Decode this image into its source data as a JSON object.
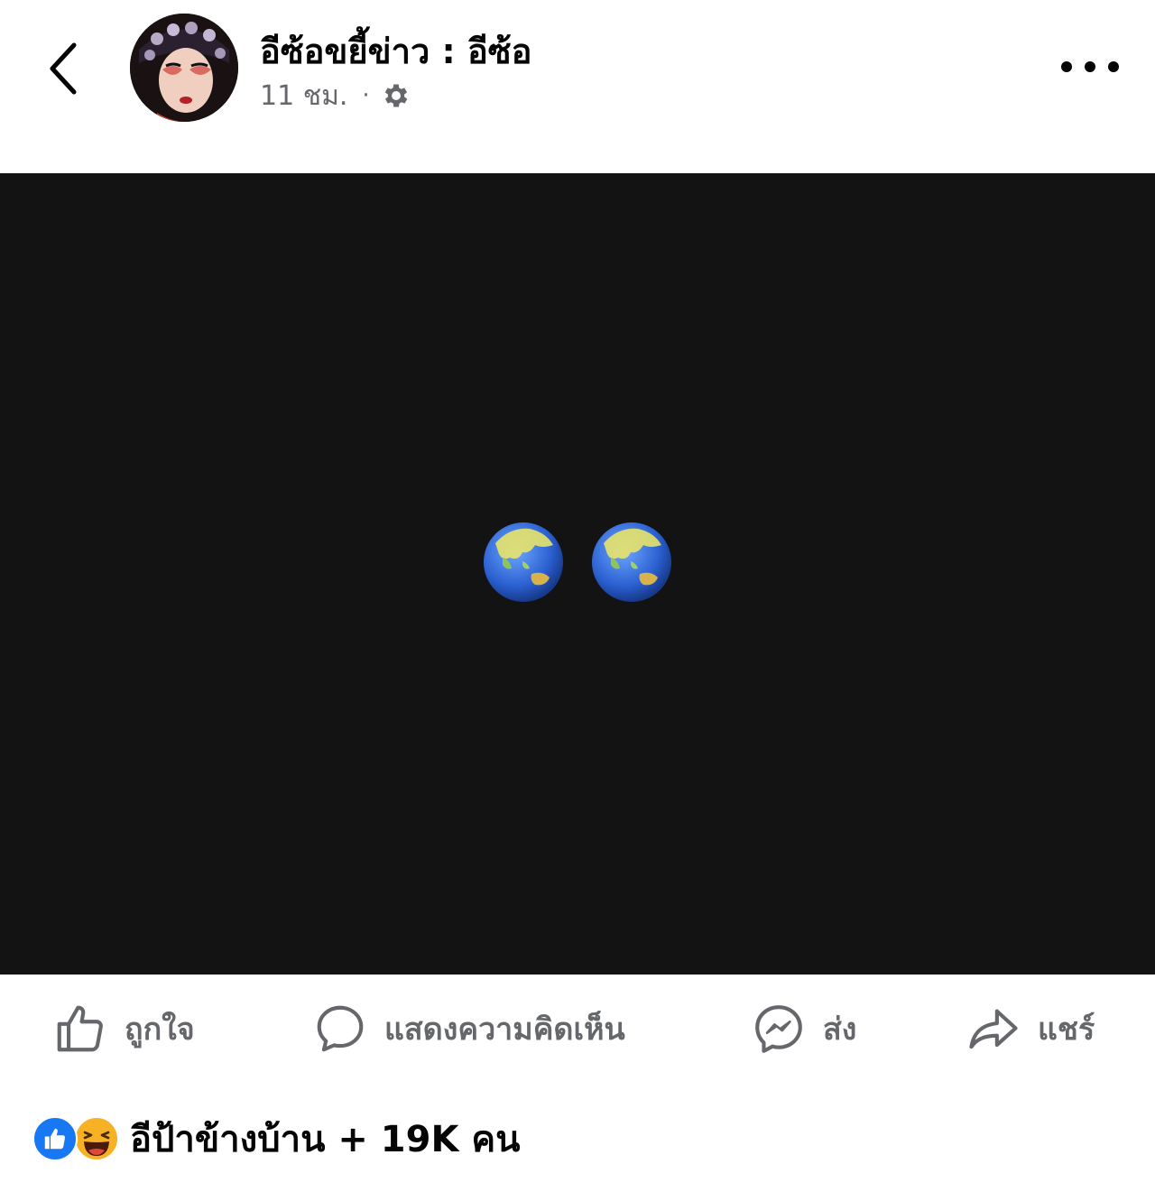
{
  "header": {
    "page_name": "อีซ้อขยี้ข่าว : อีซ้อ",
    "time": "11 ชม.",
    "separator": "·",
    "privacy_icon": "gear-icon",
    "back_icon": "chevron-left-icon",
    "more_icon": "more-horizontal-icon"
  },
  "post": {
    "media_background": "#131313",
    "content_icons": [
      "globe-asia-australia-icon",
      "globe-asia-australia-icon"
    ]
  },
  "actions": {
    "like_label": "ถูกใจ",
    "comment_label": "แสดงความคิดเห็น",
    "send_label": "ส่ง",
    "share_label": "แชร์"
  },
  "reactions": {
    "icons": [
      "like-reaction-icon",
      "haha-reaction-icon"
    ],
    "summary": "อีป้าข้างบ้าน + 19K คน"
  },
  "colors": {
    "text_secondary": "#65676b",
    "like_blue": "#1877f2",
    "haha_yellow": "#f7b125"
  }
}
